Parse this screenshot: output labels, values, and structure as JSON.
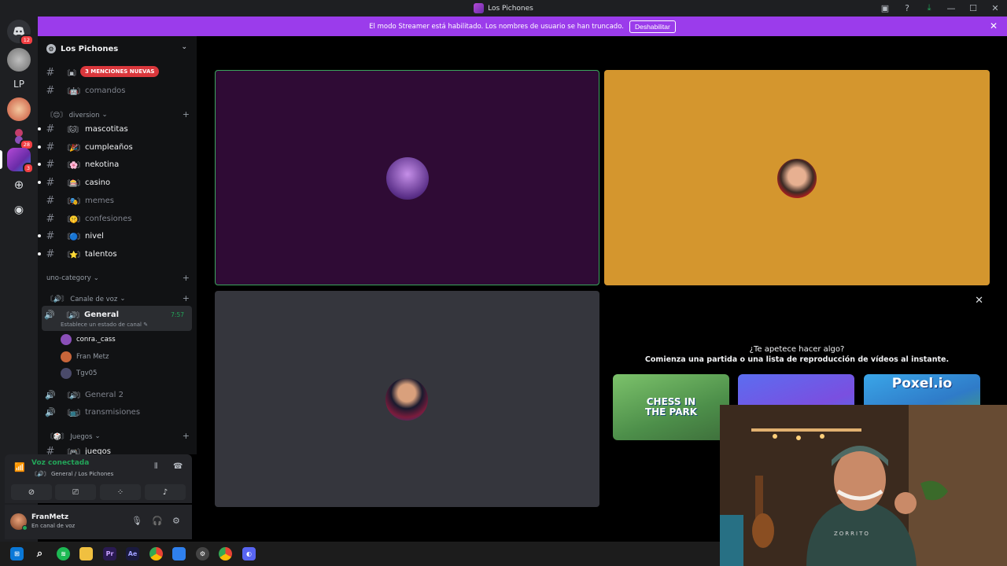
{
  "window": {
    "title": "Los Pichones"
  },
  "banner": {
    "text": "El modo Streamer está habilitado. Los nombres de usuario se han truncado.",
    "button": "Deshabilitar"
  },
  "rail": {
    "dm_badge": "12",
    "lp_label": "LP",
    "badge_28": "28",
    "badge_3": "3"
  },
  "guild": {
    "name": "Los Pichones"
  },
  "mentions_pill": "3 MENCIONES NUEVAS",
  "channels_top": [
    {
      "emoji": "〘▪〙",
      "name": ""
    },
    {
      "emoji": "〘🤖〙",
      "name": "comandos"
    }
  ],
  "categories": {
    "diversion": "〘😊〙 diversion",
    "uno": "uno-category",
    "voice": "〘🔊〙 Canale de voz",
    "juegos": "〘🎲〙 Juegos"
  },
  "channels_diversion": [
    {
      "emoji": "〘🐱〙",
      "name": "mascotitas",
      "unread": true
    },
    {
      "emoji": "〘🎉〙",
      "name": "cumpleaños",
      "unread": true
    },
    {
      "emoji": "〘🌸〙",
      "name": "nekotina",
      "unread": true
    },
    {
      "emoji": "〘🎰〙",
      "name": "casino",
      "unread": true
    },
    {
      "emoji": "〘🎭〙",
      "name": "memes",
      "unread": false
    },
    {
      "emoji": "〘🤫〙",
      "name": "confesiones",
      "unread": false
    },
    {
      "emoji": "〘🔵〙",
      "name": "nivel",
      "unread": true
    },
    {
      "emoji": "〘⭐〙",
      "name": "talentos",
      "unread": true
    }
  ],
  "voice_channels": {
    "general": {
      "emoji": "〘🔊〙",
      "name": "General",
      "timer": "7:57",
      "status": "Establece un estado de canal"
    },
    "members": [
      {
        "name": "conra._cass",
        "color": "#8a4fb8",
        "dim": false
      },
      {
        "name": "Fran Metz",
        "color": "#c8653a",
        "dim": true
      },
      {
        "name": "Tgv05",
        "color": "#4a4a6a",
        "dim": true
      }
    ],
    "general2": {
      "emoji": "〘🔊〙",
      "name": "General 2"
    },
    "transmisiones": {
      "emoji": "〘📺〙",
      "name": "transmisiones"
    },
    "juegos": {
      "emoji": "〘🎮〙",
      "name": "juegos"
    }
  },
  "voice_panel": {
    "title": "Voz conectada",
    "subtitle": "〘🔊〙 General / Los Pichones"
  },
  "user": {
    "name": "FranMetz",
    "status": "En canal de voz"
  },
  "activity": {
    "question": "¿Te apetece hacer algo?",
    "subtitle": "Comienza una partida o una lista de reproducción de vídeos al instante.",
    "cards": [
      {
        "title": "CHESS IN THE PARK"
      },
      {
        "title": ""
      },
      {
        "title": "Poxel.io"
      }
    ]
  },
  "webcam": {
    "shirt_text": "ZORRITO"
  },
  "colors": {
    "accent": "#9b3ceb",
    "speaking": "#23a559",
    "tile_purple": "#2f0b35",
    "tile_orange": "#d4962e",
    "tile_gray": "#35363d"
  },
  "taskbar_icons": [
    "windows-icon",
    "search-icon",
    "spotify-icon",
    "explorer-icon",
    "premiere-icon",
    "after-effects-icon",
    "chrome-icon",
    "paint-icon",
    "settings-icon",
    "chrome2-icon",
    "discord-icon"
  ]
}
